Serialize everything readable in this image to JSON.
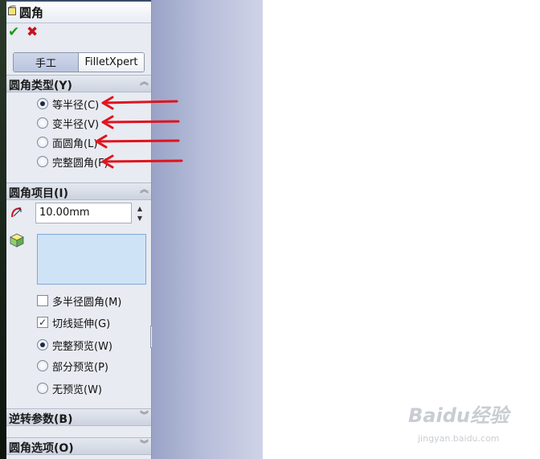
{
  "window": {
    "title": "圆角"
  },
  "actions": {
    "ok_label": "✔",
    "cancel_label": "✖"
  },
  "tabs": [
    {
      "label": "手工",
      "active": true
    },
    {
      "label": "FilletXpert",
      "active": false
    }
  ],
  "fillet_type": {
    "title": "圆角类型(Y)",
    "options": [
      {
        "label": "等半径(C)",
        "selected": true
      },
      {
        "label": "变半径(V)",
        "selected": false
      },
      {
        "label": "面圆角(L)",
        "selected": false
      },
      {
        "label": "完整圆角(F)",
        "selected": false
      }
    ]
  },
  "fillet_items": {
    "title": "圆角项目(I)",
    "radius_value": "10.00mm",
    "multi_radius": {
      "label": "多半径圆角(M)",
      "checked": false
    },
    "tangent_propagation": {
      "label": "切线延伸(G)",
      "checked": true
    },
    "preview_options": [
      {
        "label": "完整预览(W)",
        "selected": true
      },
      {
        "label": "部分预览(P)",
        "selected": false
      },
      {
        "label": "无预览(W)",
        "selected": false
      }
    ]
  },
  "setback": {
    "title": "逆转参数(B)"
  },
  "fillet_options": {
    "title": "圆角选项(O)"
  },
  "watermark": {
    "brand": "Baidu经验",
    "url": "jingyan.baidu.com"
  },
  "colors": {
    "annotation_arrow": "#e0141e",
    "panel": "#e8ebf1",
    "selection_box": "#cfe3f7"
  }
}
